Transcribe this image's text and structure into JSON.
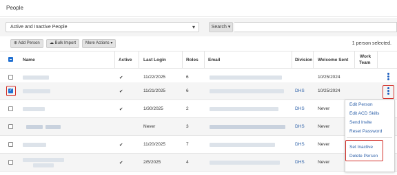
{
  "page": {
    "title": "People"
  },
  "filter": {
    "value": "Active and Inactive People",
    "search_label": "Search"
  },
  "toolbar": {
    "add_person": "Add Person",
    "bulk_import": "Bulk Import",
    "more_actions": "More Actions",
    "selection_count": "1 person selected."
  },
  "columns": {
    "name": "Name",
    "active": "Active",
    "last_login": "Last Login",
    "roles": "Roles",
    "email": "Email",
    "division": "Division",
    "welcome_sent": "Welcome Sent",
    "work_team_line1": "Work",
    "work_team_line2": "Team"
  },
  "rows": [
    {
      "active": "✔",
      "last_login": "11/22/2025",
      "roles": "6",
      "division": "",
      "welcome_sent": "10/25/2024",
      "checked": false
    },
    {
      "active": "✔",
      "last_login": "11/21/2025",
      "roles": "6",
      "division": "DHS",
      "welcome_sent": "10/25/2024",
      "checked": true
    },
    {
      "active": "✔",
      "last_login": "1/30/2025",
      "roles": "2",
      "division": "DHS",
      "welcome_sent": "Never",
      "checked": false
    },
    {
      "active": "",
      "last_login": "Never",
      "roles": "3",
      "division": "DHS",
      "welcome_sent": "Never",
      "checked": false
    },
    {
      "active": "✔",
      "last_login": "11/20/2025",
      "roles": "7",
      "division": "DHS",
      "welcome_sent": "Never",
      "checked": false
    },
    {
      "active": "✔",
      "last_login": "2/5/2025",
      "roles": "4",
      "division": "DHS",
      "welcome_sent": "Never",
      "checked": false
    }
  ],
  "context_menu": {
    "items": [
      "Edit Person",
      "Edit ACD Skills",
      "Send Invite",
      "Reset Password"
    ],
    "danger_items": [
      "Set Inactive",
      "Delete Person"
    ]
  },
  "colors": {
    "accent": "#1f6fd1",
    "link": "#2b5fa8",
    "highlight": "#d3312b"
  },
  "icons": {
    "check": "check-icon",
    "kebab": "kebab-menu-icon",
    "caret": "caret-down-icon",
    "add": "plus-icon",
    "upload": "cloud-upload-icon"
  }
}
